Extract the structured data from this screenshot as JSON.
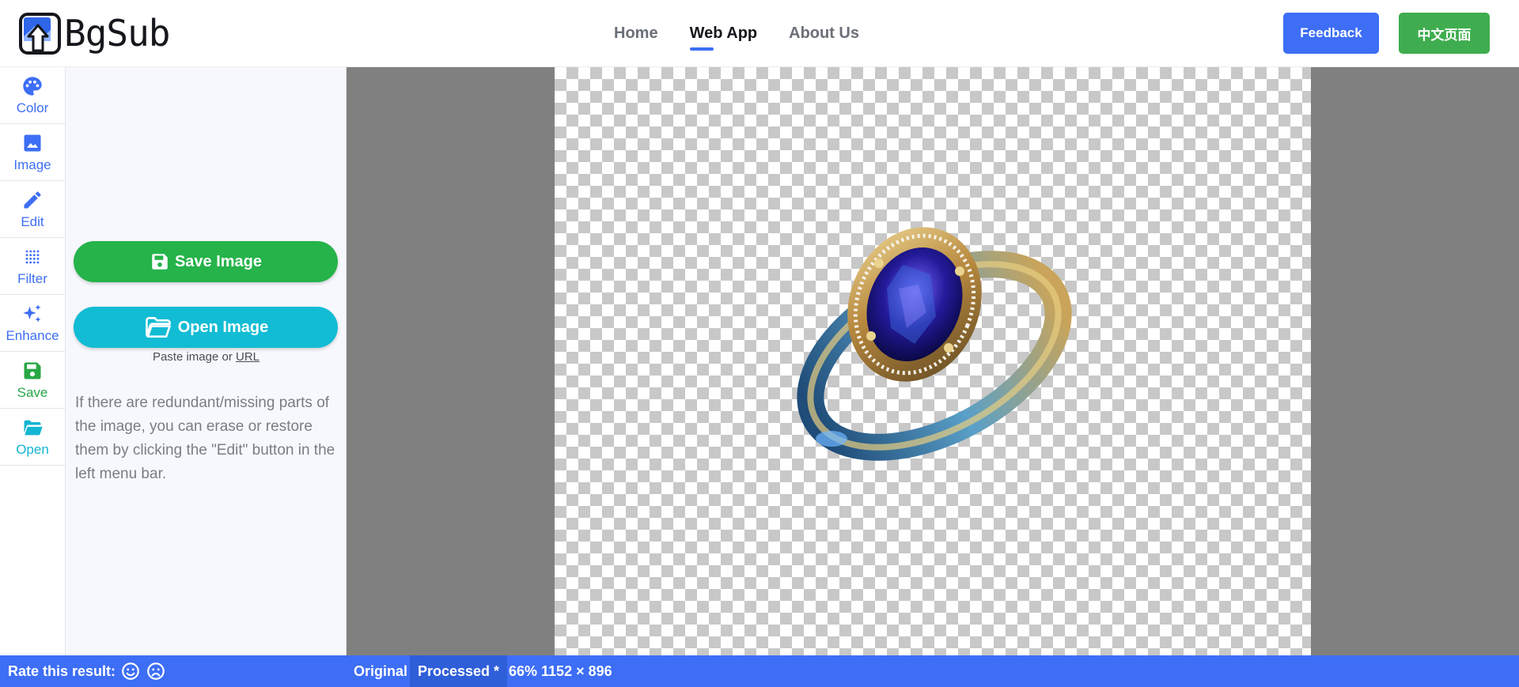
{
  "app": {
    "name": "BgSub"
  },
  "nav": {
    "links": [
      {
        "label": "Home",
        "active": false
      },
      {
        "label": "Web App",
        "active": true
      },
      {
        "label": "About Us",
        "active": false
      }
    ],
    "feedback_label": "Feedback",
    "chinese_label": "中文页面"
  },
  "sidebar": {
    "items": [
      {
        "label": "Color",
        "icon": "palette-icon"
      },
      {
        "label": "Image",
        "icon": "image-icon"
      },
      {
        "label": "Edit",
        "icon": "pencil-icon"
      },
      {
        "label": "Filter",
        "icon": "dots-grid-icon"
      },
      {
        "label": "Enhance",
        "icon": "sparkle-icon"
      },
      {
        "label": "Save",
        "icon": "floppy-disk-icon"
      },
      {
        "label": "Open",
        "icon": "folder-open-icon"
      }
    ]
  },
  "panel": {
    "save_label": "Save Image",
    "open_label": "Open Image",
    "paste_prefix": "Paste image or",
    "paste_url": "URL",
    "hint": "If there are redundant/missing parts of the image, you can erase or restore them by clicking the \"Edit\" button in the left menu bar."
  },
  "statusbar": {
    "rate_label": "Rate this result:",
    "original_label": "Original",
    "processed_label": "Processed *",
    "info": "66% 1152 × 896"
  },
  "colors": {
    "accent": "#3d6ef5",
    "green": "#25b34a",
    "cyan": "#12bcd4",
    "canvas_bg": "#808080"
  }
}
